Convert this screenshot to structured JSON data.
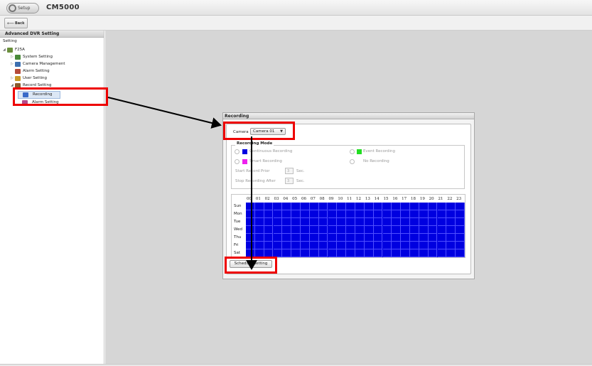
{
  "topbar": {
    "setup_label": "Setup",
    "app_title": "CM5000"
  },
  "navbar": {
    "back_label": "Back"
  },
  "sidebar": {
    "header": "Advanced DVR Setting",
    "root_label": "Setting",
    "tree": [
      {
        "label": "F25A",
        "icon": "dvr-icon"
      },
      {
        "label": "System Setting",
        "icon": "system-icon"
      },
      {
        "label": "Camera Management",
        "icon": "camera-icon"
      },
      {
        "label": "Alarm Setting",
        "icon": "alarm-icon"
      },
      {
        "label": "User Setting",
        "icon": "user-icon"
      },
      {
        "label": "Record Setting",
        "icon": "record-icon"
      },
      {
        "label": "Recording",
        "icon": "recording-icon"
      },
      {
        "label": "Alarm Setting",
        "icon": "alarm-icon"
      }
    ]
  },
  "recording": {
    "title": "Recording",
    "camera_label": "Camera",
    "camera_value": "Camera 01",
    "mode_title": "Recording Mode",
    "modes": {
      "continuous": "Continuous Recording",
      "event": "Event Recording",
      "smart": "Smart Recording",
      "none": "No Recording"
    },
    "start_prior_label": "Start Record Prior",
    "start_prior_value": "3",
    "stop_after_label": "Stop Recording After",
    "stop_after_value": "3",
    "sec_label": "Sec.",
    "hours": [
      "00",
      "01",
      "02",
      "03",
      "04",
      "05",
      "06",
      "07",
      "08",
      "09",
      "10",
      "11",
      "12",
      "13",
      "14",
      "15",
      "16",
      "17",
      "18",
      "19",
      "20",
      "21",
      "22",
      "23"
    ],
    "days": [
      "Sun",
      "Mon",
      "Tue",
      "Wed",
      "Thu",
      "Fri",
      "Sat"
    ],
    "schedule_button": "Schedule Setting"
  },
  "colors": {
    "continuous": "#0000e0",
    "event": "#22dd22",
    "smart": "#ee22ee",
    "highlight": "#ee0000",
    "grid_fill": "#0000e0"
  }
}
